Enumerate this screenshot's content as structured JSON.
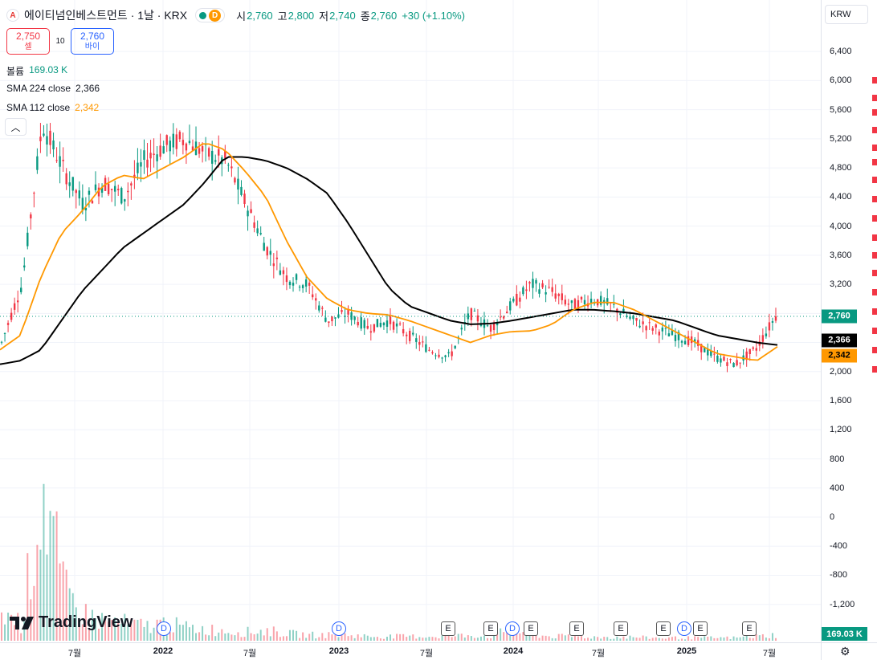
{
  "header": {
    "logo_letter": "A",
    "title": "에이티넘인베스트먼트 · 1날 · KRX",
    "status_badge": "D",
    "ohlc": [
      {
        "label": "시",
        "value": "2,760"
      },
      {
        "label": "고",
        "value": "2,800"
      },
      {
        "label": "저",
        "value": "2,740"
      },
      {
        "label": "종",
        "value": "2,760"
      }
    ],
    "change": "+30 (+1.10%)"
  },
  "trade": {
    "sell_price": "2,750",
    "sell_label": "셀",
    "spread": "10",
    "buy_price": "2,760",
    "buy_label": "바이"
  },
  "indicators": {
    "volume_label": "볼륨",
    "volume_value": "169.03 K",
    "sma224_label": "SMA 224 close",
    "sma224_value": "2,366",
    "sma112_label": "SMA 112 close",
    "sma112_value": "2,342",
    "collapse_icon": "chevron-up-icon"
  },
  "currency": "KRW",
  "price_axis": [
    "6,400",
    "6,000",
    "5,600",
    "5,200",
    "4,800",
    "4,400",
    "4,000",
    "3,600",
    "3,200",
    "2,800",
    "2,400",
    "2,000",
    "1,600",
    "1,200",
    "800",
    "400",
    "0",
    "-400",
    "-800",
    "-1,200"
  ],
  "price_tags": {
    "last": "2,760",
    "sma224": "2,366",
    "sma112": "2,342",
    "volume": "169.03 K"
  },
  "time_axis": [
    {
      "label": "7월",
      "bold": false
    },
    {
      "label": "2022",
      "bold": true
    },
    {
      "label": "7월",
      "bold": false
    },
    {
      "label": "2023",
      "bold": true
    },
    {
      "label": "7월",
      "bold": false
    },
    {
      "label": "2024",
      "bold": true
    },
    {
      "label": "7월",
      "bold": false
    },
    {
      "label": "2025",
      "bold": true
    },
    {
      "label": "7월",
      "bold": false
    }
  ],
  "events": [
    "D",
    "D",
    "E",
    "E",
    "D",
    "E",
    "E",
    "E",
    "E",
    "D",
    "E",
    "E"
  ],
  "brand": "TradingView",
  "colors": {
    "up": "#089981",
    "down": "#f23645",
    "sma224": "#000000",
    "sma112": "#ff9800",
    "accent": "#2962ff"
  },
  "chart_data": {
    "type": "line",
    "ylim": [
      -1400,
      6600
    ],
    "series": [
      {
        "name": "SMA 224 close",
        "values": [
          2100,
          2150,
          2300,
          2700,
          3100,
          3400,
          3700,
          3900,
          4100,
          4300,
          4600,
          4950,
          4950,
          4900,
          4800,
          4650,
          4450,
          4050,
          3600,
          3150,
          2900,
          2800,
          2700,
          2650,
          2660,
          2700,
          2750,
          2800,
          2850,
          2850,
          2830,
          2800,
          2750,
          2700,
          2600,
          2500,
          2450,
          2400,
          2366
        ]
      },
      {
        "name": "SMA 112 close",
        "values": [
          2300,
          2500,
          3300,
          3900,
          4200,
          4550,
          4700,
          4650,
          4800,
          4950,
          5150,
          5050,
          4750,
          4400,
          3800,
          3300,
          3000,
          2850,
          2800,
          2780,
          2700,
          2600,
          2500,
          2400,
          2500,
          2550,
          2560,
          2650,
          2850,
          2950,
          2950,
          2850,
          2700,
          2550,
          2400,
          2250,
          2200,
          2150,
          2342
        ]
      },
      {
        "name": "price",
        "values": [
          2400,
          3200,
          5400,
          4800,
          4300,
          4600,
          4400,
          4900,
          5100,
          5200,
          5000,
          4900,
          4300,
          3700,
          3300,
          3200,
          2700,
          2800,
          2600,
          2700,
          2500,
          2300,
          2200,
          2800,
          2600,
          2900,
          3200,
          3100,
          2900,
          3000,
          2900,
          2700,
          2600,
          2500,
          2400,
          2200,
          2100,
          2300,
          2760
        ]
      }
    ],
    "volume_series": [
      200,
      120,
      1100,
      350,
      180,
      140,
      120,
      100,
      120,
      90,
      80,
      70,
      60,
      70,
      50,
      40,
      40,
      40,
      30,
      30,
      30,
      30,
      30,
      40,
      30,
      80,
      40,
      30,
      30,
      25,
      25,
      25,
      20,
      20,
      20,
      20,
      20,
      30,
      40
    ]
  }
}
